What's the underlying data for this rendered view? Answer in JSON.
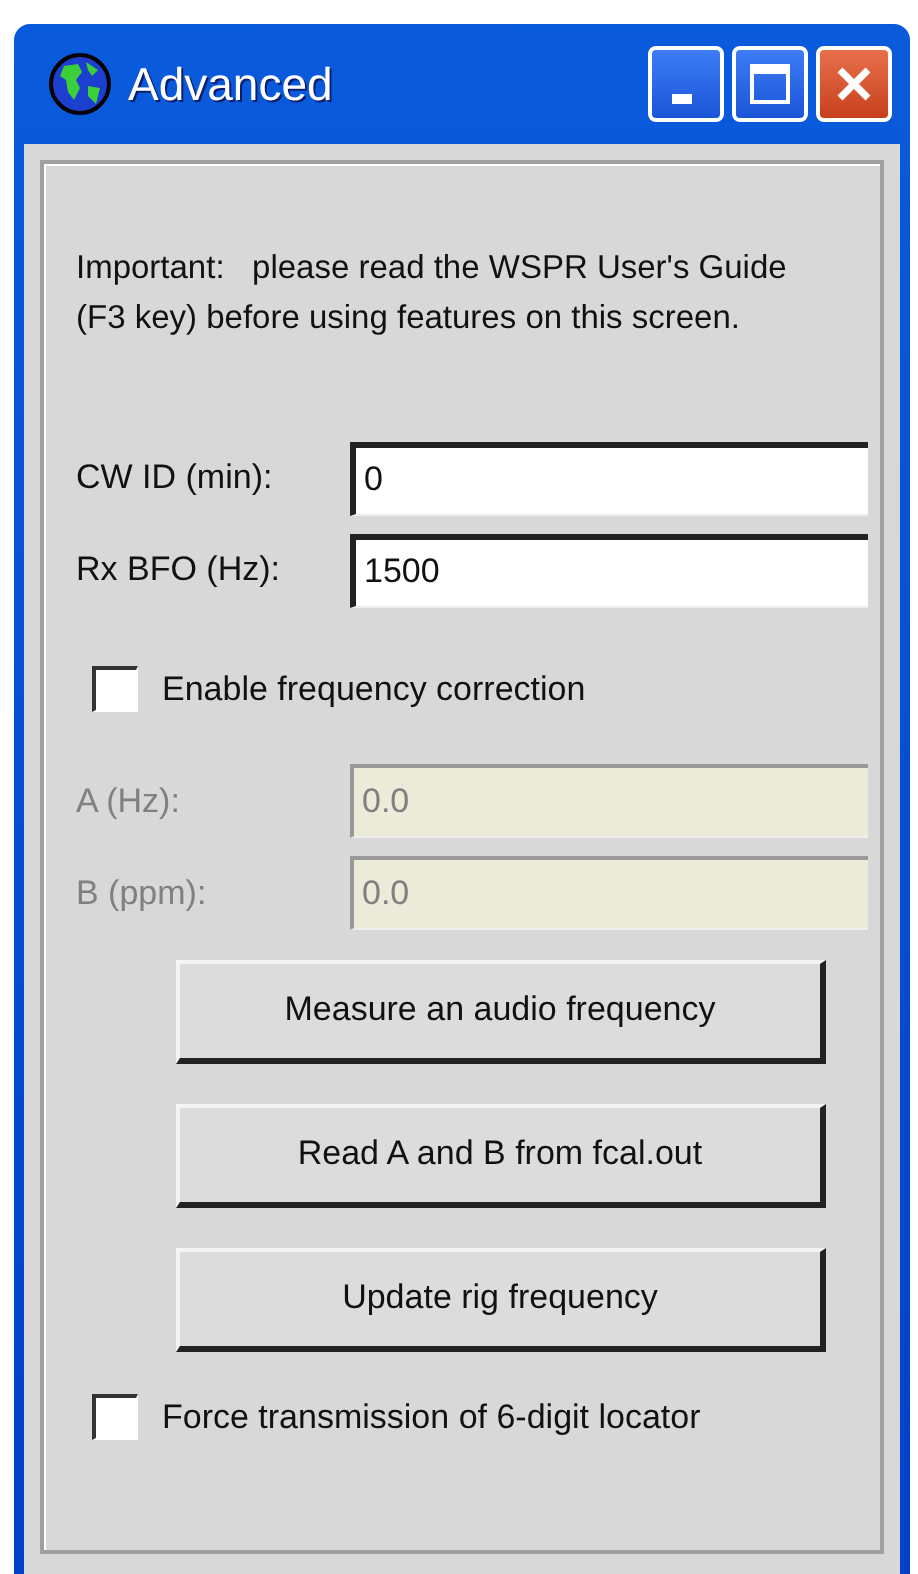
{
  "window": {
    "title": "Advanced"
  },
  "note": "Important:   please read the WSPR User's Guide (F3 key) before using features on this screen.",
  "fields": [
    {
      "label": "CW ID (min):",
      "value": "0",
      "disabled": false
    },
    {
      "label": "Rx BFO (Hz):",
      "value": "1500",
      "disabled": false
    }
  ],
  "frequency_correction": {
    "label": "Enable frequency correction",
    "checked": false
  },
  "correction_fields": [
    {
      "label": "A (Hz):",
      "value": "0.0",
      "disabled": true
    },
    {
      "label": "B (ppm):",
      "value": "0.0",
      "disabled": true
    }
  ],
  "buttons": [
    "Measure an audio frequency",
    "Read A and B from fcal.out",
    "Update rig frequency"
  ],
  "force_locator": {
    "label": "Force transmission of 6-digit locator",
    "checked": false
  }
}
